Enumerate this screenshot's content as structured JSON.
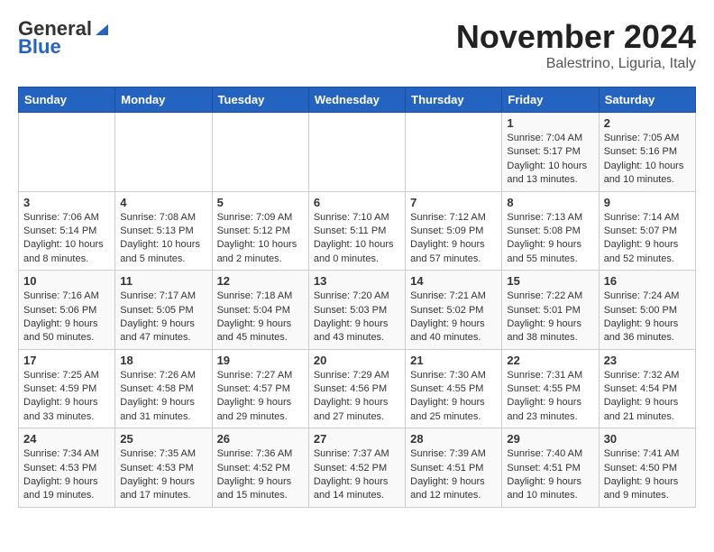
{
  "header": {
    "logo_general": "General",
    "logo_blue": "Blue",
    "month_title": "November 2024",
    "location": "Balestrino, Liguria, Italy"
  },
  "days_of_week": [
    "Sunday",
    "Monday",
    "Tuesday",
    "Wednesday",
    "Thursday",
    "Friday",
    "Saturday"
  ],
  "weeks": [
    [
      {
        "day": "",
        "info": ""
      },
      {
        "day": "",
        "info": ""
      },
      {
        "day": "",
        "info": ""
      },
      {
        "day": "",
        "info": ""
      },
      {
        "day": "",
        "info": ""
      },
      {
        "day": "1",
        "info": "Sunrise: 7:04 AM\nSunset: 5:17 PM\nDaylight: 10 hours\nand 13 minutes."
      },
      {
        "day": "2",
        "info": "Sunrise: 7:05 AM\nSunset: 5:16 PM\nDaylight: 10 hours\nand 10 minutes."
      }
    ],
    [
      {
        "day": "3",
        "info": "Sunrise: 7:06 AM\nSunset: 5:14 PM\nDaylight: 10 hours\nand 8 minutes."
      },
      {
        "day": "4",
        "info": "Sunrise: 7:08 AM\nSunset: 5:13 PM\nDaylight: 10 hours\nand 5 minutes."
      },
      {
        "day": "5",
        "info": "Sunrise: 7:09 AM\nSunset: 5:12 PM\nDaylight: 10 hours\nand 2 minutes."
      },
      {
        "day": "6",
        "info": "Sunrise: 7:10 AM\nSunset: 5:11 PM\nDaylight: 10 hours\nand 0 minutes."
      },
      {
        "day": "7",
        "info": "Sunrise: 7:12 AM\nSunset: 5:09 PM\nDaylight: 9 hours\nand 57 minutes."
      },
      {
        "day": "8",
        "info": "Sunrise: 7:13 AM\nSunset: 5:08 PM\nDaylight: 9 hours\nand 55 minutes."
      },
      {
        "day": "9",
        "info": "Sunrise: 7:14 AM\nSunset: 5:07 PM\nDaylight: 9 hours\nand 52 minutes."
      }
    ],
    [
      {
        "day": "10",
        "info": "Sunrise: 7:16 AM\nSunset: 5:06 PM\nDaylight: 9 hours\nand 50 minutes."
      },
      {
        "day": "11",
        "info": "Sunrise: 7:17 AM\nSunset: 5:05 PM\nDaylight: 9 hours\nand 47 minutes."
      },
      {
        "day": "12",
        "info": "Sunrise: 7:18 AM\nSunset: 5:04 PM\nDaylight: 9 hours\nand 45 minutes."
      },
      {
        "day": "13",
        "info": "Sunrise: 7:20 AM\nSunset: 5:03 PM\nDaylight: 9 hours\nand 43 minutes."
      },
      {
        "day": "14",
        "info": "Sunrise: 7:21 AM\nSunset: 5:02 PM\nDaylight: 9 hours\nand 40 minutes."
      },
      {
        "day": "15",
        "info": "Sunrise: 7:22 AM\nSunset: 5:01 PM\nDaylight: 9 hours\nand 38 minutes."
      },
      {
        "day": "16",
        "info": "Sunrise: 7:24 AM\nSunset: 5:00 PM\nDaylight: 9 hours\nand 36 minutes."
      }
    ],
    [
      {
        "day": "17",
        "info": "Sunrise: 7:25 AM\nSunset: 4:59 PM\nDaylight: 9 hours\nand 33 minutes."
      },
      {
        "day": "18",
        "info": "Sunrise: 7:26 AM\nSunset: 4:58 PM\nDaylight: 9 hours\nand 31 minutes."
      },
      {
        "day": "19",
        "info": "Sunrise: 7:27 AM\nSunset: 4:57 PM\nDaylight: 9 hours\nand 29 minutes."
      },
      {
        "day": "20",
        "info": "Sunrise: 7:29 AM\nSunset: 4:56 PM\nDaylight: 9 hours\nand 27 minutes."
      },
      {
        "day": "21",
        "info": "Sunrise: 7:30 AM\nSunset: 4:55 PM\nDaylight: 9 hours\nand 25 minutes."
      },
      {
        "day": "22",
        "info": "Sunrise: 7:31 AM\nSunset: 4:55 PM\nDaylight: 9 hours\nand 23 minutes."
      },
      {
        "day": "23",
        "info": "Sunrise: 7:32 AM\nSunset: 4:54 PM\nDaylight: 9 hours\nand 21 minutes."
      }
    ],
    [
      {
        "day": "24",
        "info": "Sunrise: 7:34 AM\nSunset: 4:53 PM\nDaylight: 9 hours\nand 19 minutes."
      },
      {
        "day": "25",
        "info": "Sunrise: 7:35 AM\nSunset: 4:53 PM\nDaylight: 9 hours\nand 17 minutes."
      },
      {
        "day": "26",
        "info": "Sunrise: 7:36 AM\nSunset: 4:52 PM\nDaylight: 9 hours\nand 15 minutes."
      },
      {
        "day": "27",
        "info": "Sunrise: 7:37 AM\nSunset: 4:52 PM\nDaylight: 9 hours\nand 14 minutes."
      },
      {
        "day": "28",
        "info": "Sunrise: 7:39 AM\nSunset: 4:51 PM\nDaylight: 9 hours\nand 12 minutes."
      },
      {
        "day": "29",
        "info": "Sunrise: 7:40 AM\nSunset: 4:51 PM\nDaylight: 9 hours\nand 10 minutes."
      },
      {
        "day": "30",
        "info": "Sunrise: 7:41 AM\nSunset: 4:50 PM\nDaylight: 9 hours\nand 9 minutes."
      }
    ]
  ]
}
